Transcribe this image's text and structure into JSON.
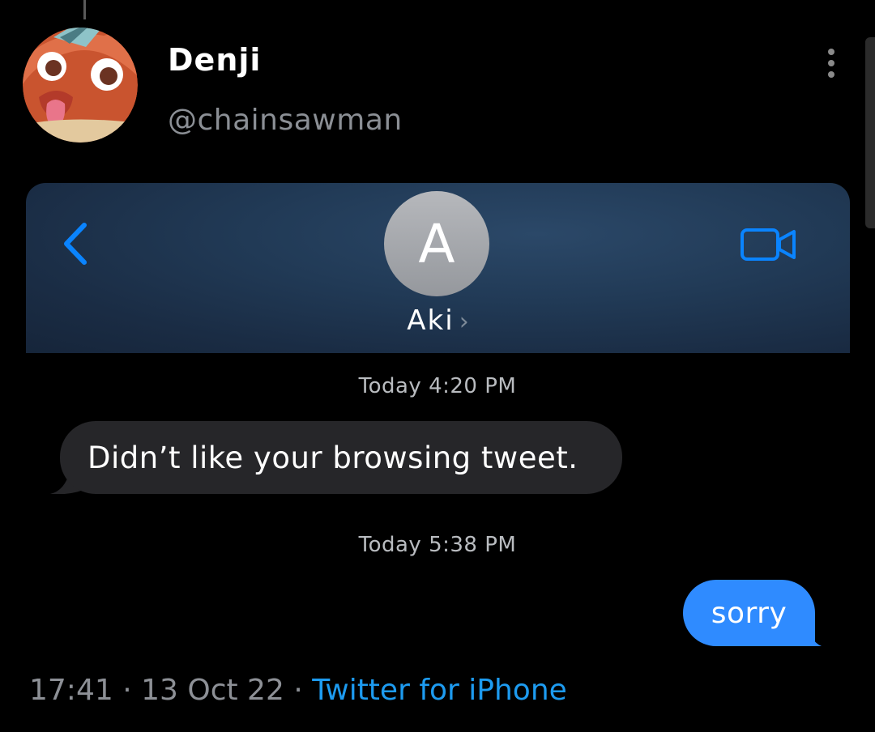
{
  "tweet": {
    "display_name": "Denji",
    "handle": "@chainsawman",
    "time": "17:41",
    "date": "13 Oct 22",
    "source": "Twitter for iPhone",
    "separator": "·"
  },
  "imessage": {
    "contact_initial": "A",
    "contact_name": "Aki",
    "contact_chevron": "›",
    "accent_color": "#0a84ff",
    "messages": [
      {
        "timestamp": "Today 4:20 PM",
        "direction": "received",
        "text": "Didn’t like your browsing tweet."
      },
      {
        "timestamp": "Today 5:38 PM",
        "direction": "sent",
        "text": "sorry"
      }
    ]
  },
  "icons": {
    "more": "more-vertical-icon",
    "back": "chevron-left-icon",
    "video": "video-camera-icon",
    "avatar": "chainsaw-devil-avatar"
  },
  "colors": {
    "background": "#000000",
    "sent_bubble": "#2f8bff",
    "received_bubble": "#262629",
    "link": "#1d9bf0",
    "secondary_text": "#8d9096"
  }
}
